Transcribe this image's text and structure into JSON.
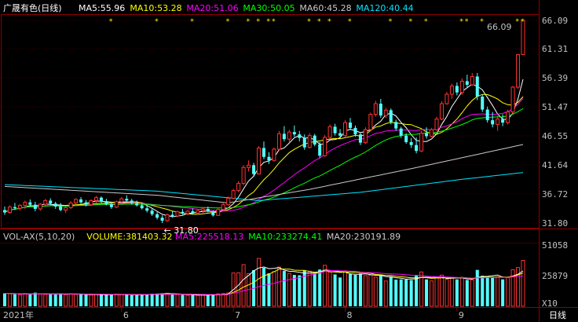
{
  "chart_data": [
    {
      "type": "candlestick",
      "title": "广晟有色(日线)",
      "ma_labels": [
        {
          "text": "MA5:55.96",
          "color": "#ffffff"
        },
        {
          "text": "MA10:53.28",
          "color": "#ffff00"
        },
        {
          "text": "MA20:51.06",
          "color": "#ff00ff"
        },
        {
          "text": "MA30:50.05",
          "color": "#00ff00"
        },
        {
          "text": "MA60:45.28",
          "color": "#c8c8c8"
        },
        {
          "text": "MA120:40.44",
          "color": "#00e5ff"
        }
      ],
      "y_ticks": [
        "66.09",
        "61.31",
        "56.39",
        "51.47",
        "46.55",
        "41.64",
        "36.72",
        "31.80"
      ],
      "ylim": [
        31.8,
        66.09
      ],
      "low_annotation": "31.80",
      "high_annotation": "66.09",
      "x_ticks": [
        "2021年",
        "6",
        "7",
        "8",
        "9"
      ],
      "period_label": "日线",
      "candles": [
        [
          34.0,
          34.6,
          33.2,
          33.6
        ],
        [
          33.6,
          34.8,
          33.4,
          34.5
        ],
        [
          34.5,
          35.2,
          34.0,
          34.3
        ],
        [
          34.3,
          35.0,
          33.9,
          34.8
        ],
        [
          34.8,
          35.6,
          34.2,
          35.3
        ],
        [
          35.3,
          35.8,
          34.6,
          34.9
        ],
        [
          34.9,
          35.4,
          33.8,
          34.2
        ],
        [
          34.2,
          35.2,
          33.9,
          35.0
        ],
        [
          35.0,
          35.9,
          34.7,
          35.6
        ],
        [
          35.6,
          36.0,
          34.8,
          35.1
        ],
        [
          35.1,
          35.4,
          34.2,
          34.6
        ],
        [
          34.6,
          35.2,
          33.8,
          34.0
        ],
        [
          34.0,
          34.6,
          33.5,
          34.4
        ],
        [
          34.4,
          35.5,
          34.2,
          35.2
        ],
        [
          35.2,
          36.0,
          34.8,
          35.8
        ],
        [
          35.8,
          36.2,
          35.0,
          35.3
        ],
        [
          35.3,
          35.7,
          34.6,
          34.9
        ],
        [
          34.9,
          35.8,
          34.7,
          35.6
        ],
        [
          35.6,
          36.4,
          35.2,
          36.1
        ],
        [
          36.1,
          36.3,
          35.2,
          35.5
        ],
        [
          35.5,
          35.9,
          34.8,
          35.0
        ],
        [
          35.0,
          35.4,
          34.2,
          34.5
        ],
        [
          34.5,
          35.6,
          34.3,
          35.4
        ],
        [
          35.4,
          36.2,
          35.0,
          35.9
        ],
        [
          35.9,
          36.5,
          35.4,
          35.6
        ],
        [
          35.6,
          35.9,
          34.9,
          35.2
        ],
        [
          35.2,
          35.6,
          34.6,
          34.8
        ],
        [
          34.8,
          35.3,
          34.1,
          34.3
        ],
        [
          34.3,
          34.8,
          33.6,
          33.9
        ],
        [
          33.9,
          34.3,
          33.0,
          33.3
        ],
        [
          33.3,
          33.7,
          32.4,
          32.7
        ],
        [
          32.7,
          33.1,
          31.8,
          32.2
        ],
        [
          32.2,
          33.4,
          32.0,
          33.2
        ],
        [
          33.2,
          33.8,
          32.7,
          33.0
        ],
        [
          33.0,
          33.9,
          32.8,
          33.7
        ],
        [
          33.7,
          34.2,
          33.2,
          33.4
        ],
        [
          33.4,
          34.0,
          33.1,
          33.8
        ],
        [
          33.8,
          34.3,
          33.3,
          33.5
        ],
        [
          33.5,
          34.1,
          33.2,
          33.9
        ],
        [
          33.9,
          34.5,
          33.5,
          34.2
        ],
        [
          34.2,
          34.6,
          33.6,
          33.8
        ],
        [
          33.8,
          34.0,
          32.9,
          33.1
        ],
        [
          33.1,
          34.3,
          33.0,
          34.1
        ],
        [
          34.1,
          35.2,
          33.8,
          34.9
        ],
        [
          34.9,
          36.3,
          34.7,
          36.0
        ],
        [
          36.0,
          37.6,
          35.8,
          37.3
        ],
        [
          37.3,
          38.9,
          37.0,
          38.5
        ],
        [
          38.5,
          41.6,
          38.2,
          41.2
        ],
        [
          41.2,
          42.4,
          40.5,
          41.6
        ],
        [
          41.6,
          42.0,
          39.6,
          40.1
        ],
        [
          40.1,
          44.8,
          40.0,
          44.5
        ],
        [
          44.5,
          45.6,
          42.6,
          43.0
        ],
        [
          43.0,
          43.8,
          41.8,
          42.4
        ],
        [
          42.4,
          44.6,
          42.2,
          44.3
        ],
        [
          44.3,
          47.4,
          44.0,
          46.9
        ],
        [
          46.9,
          48.2,
          45.6,
          46.0
        ],
        [
          46.0,
          47.6,
          45.4,
          47.2
        ],
        [
          47.2,
          48.3,
          46.4,
          46.8
        ],
        [
          46.8,
          47.4,
          45.6,
          46.2
        ],
        [
          46.2,
          46.8,
          44.2,
          44.6
        ],
        [
          44.6,
          47.0,
          44.4,
          46.6
        ],
        [
          46.6,
          46.9,
          44.8,
          45.1
        ],
        [
          45.1,
          45.5,
          42.8,
          43.2
        ],
        [
          43.2,
          46.7,
          43.0,
          46.3
        ],
        [
          46.3,
          48.5,
          46.0,
          48.1
        ],
        [
          48.1,
          48.6,
          46.6,
          47.0
        ],
        [
          47.0,
          47.7,
          46.3,
          46.6
        ],
        [
          46.6,
          49.2,
          46.4,
          48.8
        ],
        [
          48.8,
          49.6,
          47.5,
          47.9
        ],
        [
          47.9,
          48.3,
          46.4,
          46.8
        ],
        [
          46.8,
          47.1,
          45.0,
          45.4
        ],
        [
          45.4,
          48.0,
          45.2,
          47.6
        ],
        [
          47.6,
          50.5,
          47.4,
          50.2
        ],
        [
          50.2,
          52.5,
          49.8,
          52.0
        ],
        [
          52.0,
          52.8,
          49.6,
          50.0
        ],
        [
          50.0,
          51.3,
          49.6,
          50.9
        ],
        [
          50.9,
          51.2,
          48.5,
          48.9
        ],
        [
          48.9,
          49.3,
          47.4,
          47.8
        ],
        [
          47.8,
          48.1,
          46.2,
          46.6
        ],
        [
          46.6,
          47.0,
          45.2,
          45.5
        ],
        [
          45.5,
          46.2,
          44.5,
          45.0
        ],
        [
          45.0,
          46.3,
          43.6,
          44.0
        ],
        [
          44.0,
          47.4,
          43.8,
          47.0
        ],
        [
          47.0,
          48.0,
          46.1,
          46.5
        ],
        [
          46.5,
          47.9,
          46.3,
          47.6
        ],
        [
          47.6,
          49.8,
          47.4,
          49.4
        ],
        [
          49.4,
          52.4,
          49.2,
          52.0
        ],
        [
          52.0,
          54.0,
          51.8,
          53.6
        ],
        [
          53.6,
          55.4,
          52.8,
          55.0
        ],
        [
          55.0,
          55.6,
          53.4,
          53.9
        ],
        [
          53.9,
          56.3,
          53.5,
          55.8
        ],
        [
          55.8,
          56.9,
          54.8,
          55.2
        ],
        [
          55.2,
          57.2,
          55.0,
          56.6
        ],
        [
          56.6,
          57.2,
          52.6,
          53.2
        ],
        [
          53.2,
          53.6,
          50.6,
          51.0
        ],
        [
          51.0,
          51.5,
          48.8,
          49.2
        ],
        [
          49.2,
          50.6,
          48.0,
          48.5
        ],
        [
          48.5,
          50.0,
          47.4,
          49.4
        ],
        [
          49.4,
          50.2,
          48.2,
          48.8
        ],
        [
          48.8,
          51.0,
          48.5,
          50.6
        ],
        [
          50.6,
          55.0,
          50.2,
          54.8
        ],
        [
          54.8,
          60.4,
          54.5,
          60.3
        ],
        [
          60.3,
          66.09,
          60.3,
          66.09
        ]
      ],
      "series": [
        {
          "name": "MA5",
          "color": "#ffffff"
        },
        {
          "name": "MA10",
          "color": "#ffff00"
        },
        {
          "name": "MA20",
          "color": "#ff00ff"
        },
        {
          "name": "MA30",
          "color": "#00ff00"
        },
        {
          "name": "MA60",
          "color": "#c8c8c8"
        },
        {
          "name": "MA120",
          "color": "#00e5ff"
        }
      ],
      "ma_anchors": {
        "MA60": [
          [
            0,
            38.0
          ],
          [
            30,
            36.5
          ],
          [
            44,
            35.2
          ],
          [
            60,
            37.5
          ],
          [
            80,
            41.0
          ],
          [
            103,
            45.28
          ]
        ],
        "MA120": [
          [
            0,
            38.3
          ],
          [
            30,
            37.2
          ],
          [
            50,
            35.6
          ],
          [
            70,
            37.0
          ],
          [
            90,
            39.2
          ],
          [
            103,
            40.44
          ]
        ]
      }
    },
    {
      "type": "bar",
      "title": "VOL-AX(5,10,20)",
      "labels": [
        {
          "text": "VOL-AX(5,10,20)",
          "color": "#c8c8c8"
        },
        {
          "text": "VOLUME:381403.32",
          "color": "#ffff00"
        },
        {
          "text": "MA5:225518.13",
          "color": "#ff00ff"
        },
        {
          "text": "MA10:233274.41",
          "color": "#00ff00"
        },
        {
          "text": "MA20:230191.89",
          "color": "#c8c8c8"
        }
      ],
      "y_ticks": [
        "51058",
        "25879",
        "X10"
      ],
      "ylim": [
        0,
        51058
      ],
      "series": [
        {
          "name": "MA5",
          "color": "#ffffff"
        },
        {
          "name": "MA10",
          "color": "#ffff00"
        },
        {
          "name": "MA20",
          "color": "#ff00ff"
        }
      ]
    }
  ]
}
